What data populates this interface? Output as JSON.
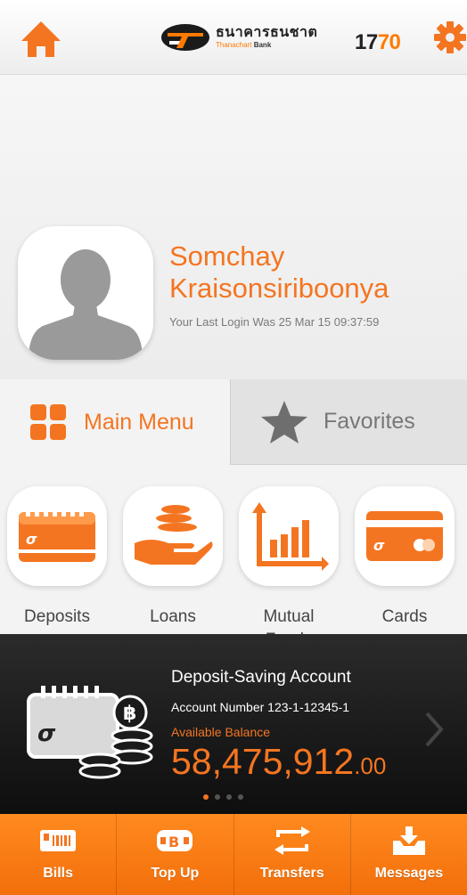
{
  "header": {
    "logo_thai": "ธนาคารธนชาต",
    "logo_en_prefix": "Thanachart",
    "logo_en_suffix": "Bank",
    "hotline_prefix": "17",
    "hotline_suffix": "70",
    "home_icon": "home-icon",
    "settings_icon": "gear-icon"
  },
  "profile": {
    "name_first": "Somchay",
    "name_last": "Kraisonsiriboonya",
    "last_login": "Your Last Login Was 25 Mar 15 09:37:59"
  },
  "tabs": {
    "main_menu": "Main Menu",
    "favorites": "Favorites"
  },
  "menu": {
    "items": [
      {
        "label": "Deposits",
        "icon": "deposits-icon"
      },
      {
        "label": "Loans",
        "icon": "loans-icon"
      },
      {
        "label": "Mutual Funds",
        "icon": "mutual-funds-icon"
      },
      {
        "label": "Cards",
        "icon": "cards-icon"
      }
    ]
  },
  "account": {
    "title": "Deposit-Saving Account",
    "number": "Account Number 123-1-12345-1",
    "available_label": "Available Balance",
    "balance_main": "58,475,912",
    "balance_cents": ".00",
    "pager": {
      "count": 4,
      "active_index": 0
    }
  },
  "bottom_nav": {
    "items": [
      {
        "label": "Bills",
        "icon": "bills-icon"
      },
      {
        "label": "Top Up",
        "icon": "top-up-icon"
      },
      {
        "label": "Transfers",
        "icon": "transfers-icon"
      },
      {
        "label": "Messages",
        "icon": "messages-icon"
      }
    ]
  },
  "colors": {
    "accent": "#f47521",
    "nav_bg": "#f36f0b",
    "panel_bg": "#1a1a1a"
  }
}
